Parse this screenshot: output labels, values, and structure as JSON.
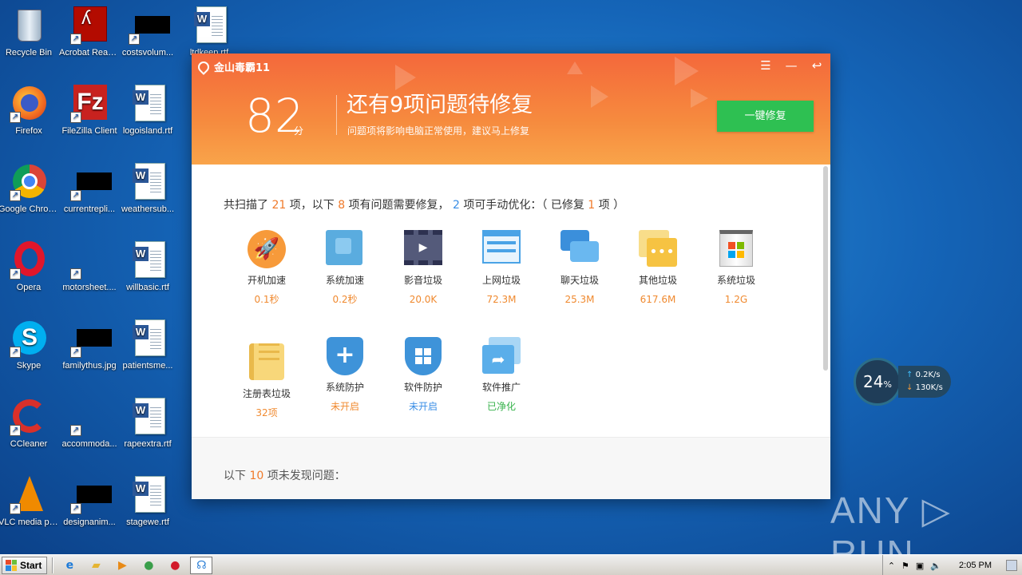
{
  "desktop": {
    "icons": [
      {
        "label": "Recycle Bin",
        "icon": "recycle-bin"
      },
      {
        "label": "Acrobat Reader DC",
        "icon": "acrobat"
      },
      {
        "label": "costsvolum...",
        "icon": "black-file"
      },
      {
        "label": "ltdkeep.rtf",
        "icon": "word-doc"
      },
      {
        "label": "Firefox",
        "icon": "firefox"
      },
      {
        "label": "FileZilla Client",
        "icon": "filezilla"
      },
      {
        "label": "logoisland.rtf",
        "icon": "word-doc"
      },
      {
        "label": "Google Chrome",
        "icon": "chrome"
      },
      {
        "label": "currentrepli...",
        "icon": "black-file"
      },
      {
        "label": "weathersub...",
        "icon": "word-doc"
      },
      {
        "label": "Opera",
        "icon": "opera"
      },
      {
        "label": "motorsheet....",
        "icon": "blank-file"
      },
      {
        "label": "willbasic.rtf",
        "icon": "word-doc"
      },
      {
        "label": "Skype",
        "icon": "skype"
      },
      {
        "label": "familythus.jpg",
        "icon": "black-file"
      },
      {
        "label": "patientsme...",
        "icon": "word-doc"
      },
      {
        "label": "CCleaner",
        "icon": "ccleaner"
      },
      {
        "label": "accommoda...",
        "icon": "blank-file"
      },
      {
        "label": "rapeextra.rtf",
        "icon": "word-doc"
      },
      {
        "label": "VLC media player",
        "icon": "vlc"
      },
      {
        "label": "designanim...",
        "icon": "black-file"
      },
      {
        "label": "stagewe.rtf",
        "icon": "word-doc"
      }
    ]
  },
  "app": {
    "title": "金山毒霸11",
    "controls": {
      "menu": "☰",
      "minimize": "—",
      "back": "↩"
    },
    "score": "82",
    "score_unit": "分",
    "headline": "还有9项问题待修复",
    "subline": "问题项将影响电脑正常使用，建议马上修复",
    "fix_button": "一键修复",
    "summary": {
      "p1": "共扫描了 ",
      "n1": "21",
      "p2": " 项，以下 ",
      "n2": "8",
      "p3": " 项有问题需要修复，  ",
      "n3": "2",
      "p4": " 项可手动优化：（ 已修复 ",
      "n4": "1",
      "p5": " 项 ）"
    },
    "items": [
      {
        "name": "开机加速",
        "value": "0.1秒",
        "status": "orange",
        "icon": "rocket-icon"
      },
      {
        "name": "系统加速",
        "value": "0.2秒",
        "status": "orange",
        "icon": "puzzle-icon"
      },
      {
        "name": "影音垃圾",
        "value": "20.0K",
        "status": "orange",
        "icon": "film-icon"
      },
      {
        "name": "上网垃圾",
        "value": "72.3M",
        "status": "orange",
        "icon": "browser-icon"
      },
      {
        "name": "聊天垃圾",
        "value": "25.3M",
        "status": "orange",
        "icon": "chat-icon"
      },
      {
        "name": "其他垃圾",
        "value": "617.6M",
        "status": "orange",
        "icon": "folder-dots-icon"
      },
      {
        "name": "系统垃圾",
        "value": "1.2G",
        "status": "orange",
        "icon": "windows-bin-icon"
      },
      {
        "name": "注册表垃圾",
        "value": "32项",
        "status": "orange",
        "icon": "scroll-icon"
      },
      {
        "name": "系统防护",
        "value": "未开启",
        "status": "orange",
        "icon": "shield-plus-icon"
      },
      {
        "name": "软件防护",
        "value": "未开启",
        "status": "blue",
        "icon": "shield-grid-icon"
      },
      {
        "name": "软件推广",
        "value": "已净化",
        "status": "green",
        "icon": "share-window-icon"
      }
    ],
    "footer": {
      "p1": "以下 ",
      "n1": "10",
      "p2": " 项未发现问题："
    }
  },
  "net_widget": {
    "cpu": "24",
    "cpu_unit": "%",
    "up": "0.2",
    "up_unit": "K/s",
    "down": "130",
    "down_unit": "K/s"
  },
  "watermark": "ANY ▷ RUN",
  "taskbar": {
    "start": "Start",
    "time": "2:05 PM"
  }
}
